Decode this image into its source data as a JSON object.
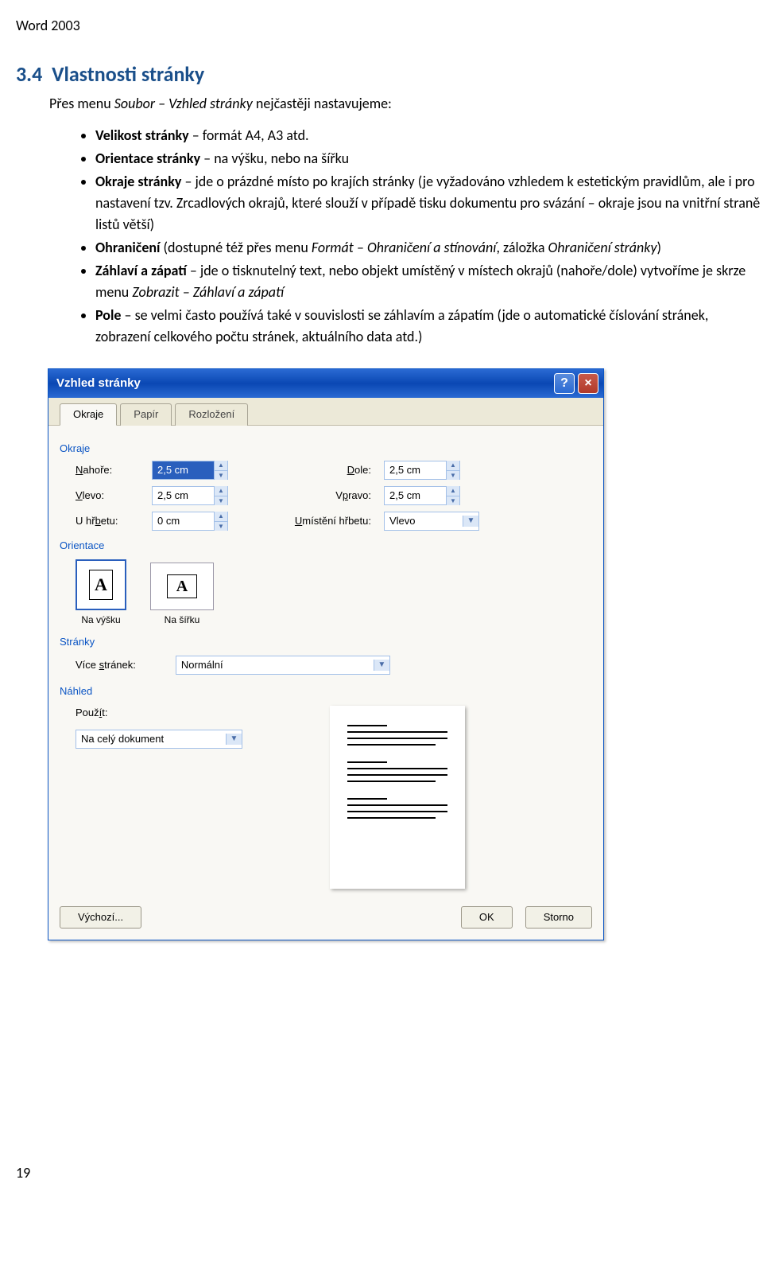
{
  "header": "Word 2003",
  "section_number": "3.4",
  "section_title": "Vlastnosti stránky",
  "intro_pre": "Přes menu ",
  "intro_it": "Soubor – Vzhled stránky",
  "intro_post": " nejčastěji nastavujeme:",
  "bullets": {
    "b1_bold": "Velikost stránky ",
    "b1_rest": "– formát A4, A3 atd.",
    "b2_bold": "Orientace stránky ",
    "b2_rest": "– na výšku, nebo na šířku",
    "b3_bold": "Okraje stránky ",
    "b3_rest": "– jde o prázdné místo po krajích stránky (je vyžadováno vzhledem k estetickým pravidlům, ale i pro nastavení tzv. Zrcadlových okrajů, které slouží v případě tisku dokumentu pro svázání – okraje jsou na vnitřní straně listů větší)",
    "b4_bold": "Ohraničení ",
    "b4_mid1": "(dostupné též přes menu ",
    "b4_it1": "Formát – Ohraničení a stínování",
    "b4_mid2": ", záložka ",
    "b4_it2": "Ohraničení stránky",
    "b4_end": ")",
    "b5_bold": "Záhlaví a zápatí ",
    "b5_mid1": "– jde o tisknutelný text, nebo objekt umístěný v místech okrajů (nahoře/dole) vytvoříme je skrze menu ",
    "b5_it": "Zobrazit – Záhlaví a zápatí",
    "b6_bold": "Pole ",
    "b6_rest": "– se velmi často používá také v souvislosti se záhlavím a zápatím (jde o automatické číslování stránek, zobrazení celkového počtu stránek, aktuálního data atd.)"
  },
  "dialog": {
    "title": "Vzhled stránky",
    "tabs": {
      "t1": "Okraje",
      "t2": "Papír",
      "t3": "Rozložení"
    },
    "group_okraje": "Okraje",
    "group_orientace": "Orientace",
    "group_stranky": "Stránky",
    "group_nahled": "Náhled",
    "lbl_nahore": "Nahoře:",
    "lbl_dole": "Dole:",
    "lbl_vlevo": "Vlevo:",
    "lbl_vpravo": "Vpravo:",
    "lbl_uhrbetu": "U hřbetu:",
    "lbl_umisteni": "Umístění hřbetu:",
    "lbl_vice": "Více stránek:",
    "lbl_pouzit": "Použít:",
    "val_25": "2,5 cm",
    "val_0": "0 cm",
    "val_vlevo": "Vlevo",
    "val_normalni": "Normální",
    "val_nacely": "Na celý dokument",
    "orient_portrait": "Na výšku",
    "orient_landscape": "Na šířku",
    "btn_vychozi": "Výchozí...",
    "btn_ok": "OK",
    "btn_storno": "Storno",
    "iconA": "A"
  },
  "footer_pagenum": "19"
}
